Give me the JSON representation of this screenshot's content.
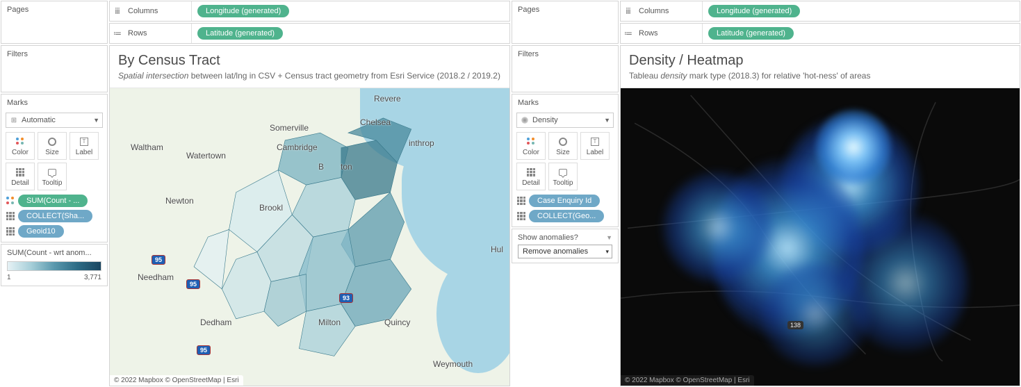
{
  "left": {
    "pages_label": "Pages",
    "filters_label": "Filters",
    "columns_label": "Columns",
    "rows_label": "Rows",
    "columns_pill": "Longitude (generated)",
    "rows_pill": "Latitude (generated)",
    "marks_label": "Marks",
    "mark_type": "Automatic",
    "mark_buttons": {
      "color": "Color",
      "size": "Size",
      "label": "Label",
      "detail": "Detail",
      "tooltip": "Tooltip"
    },
    "mark_pills": [
      {
        "icon": "color",
        "text": "SUM(Count - ..."
      },
      {
        "icon": "detail",
        "text": "COLLECT(Sha..."
      },
      {
        "icon": "detail",
        "text": "Geoid10"
      }
    ],
    "legend": {
      "title": "SUM(Count - wrt anom...",
      "min": "1",
      "max": "3,771"
    },
    "viz_title": "By Census Tract",
    "viz_subtitle_italic": "Spatial intersection",
    "viz_subtitle_rest": " between lat/lng in CSV + Census tract geometry from Esri Service (2018.2 / 2019.2)",
    "cities": {
      "revere": "Revere",
      "chelsea": "Chelsea",
      "somerville": "Somerville",
      "cambridge": "Cambridge",
      "waltham": "Waltham",
      "watertown": "Watertown",
      "winthrop": "inthrop",
      "newton": "Newton",
      "brookline": "Brookl",
      "needham": "Needham",
      "dedham": "Dedham",
      "milton": "Milton",
      "quincy": "Quincy",
      "weymouth": "Weymouth",
      "hull": "Hul",
      "boston_partial": "B",
      "ton": "ton"
    },
    "routes": {
      "i95a": "95",
      "i95b": "95",
      "i95c": "95",
      "i93": "93"
    },
    "attribution": "© 2022 Mapbox © OpenStreetMap | Esri"
  },
  "right": {
    "pages_label": "Pages",
    "filters_label": "Filters",
    "columns_label": "Columns",
    "rows_label": "Rows",
    "columns_pill": "Longitude (generated)",
    "rows_pill": "Latitude (generated)",
    "marks_label": "Marks",
    "mark_type": "Density",
    "mark_buttons": {
      "color": "Color",
      "size": "Size",
      "label": "Label",
      "detail": "Detail",
      "tooltip": "Tooltip"
    },
    "mark_pills": [
      {
        "icon": "detail",
        "text": "Case Enquiry Id"
      },
      {
        "icon": "detail",
        "text": "COLLECT(Geo..."
      }
    ],
    "param": {
      "title": "Show anomalies?",
      "value": "Remove anomalies"
    },
    "viz_title": "Density / Heatmap",
    "viz_subtitle_pre": "Tableau ",
    "viz_subtitle_italic": "density",
    "viz_subtitle_post": " mark type (2018.3) for relative 'hot-ness' of areas",
    "route_138": "138",
    "attribution": "© 2022 Mapbox © OpenStreetMap | Esri"
  }
}
